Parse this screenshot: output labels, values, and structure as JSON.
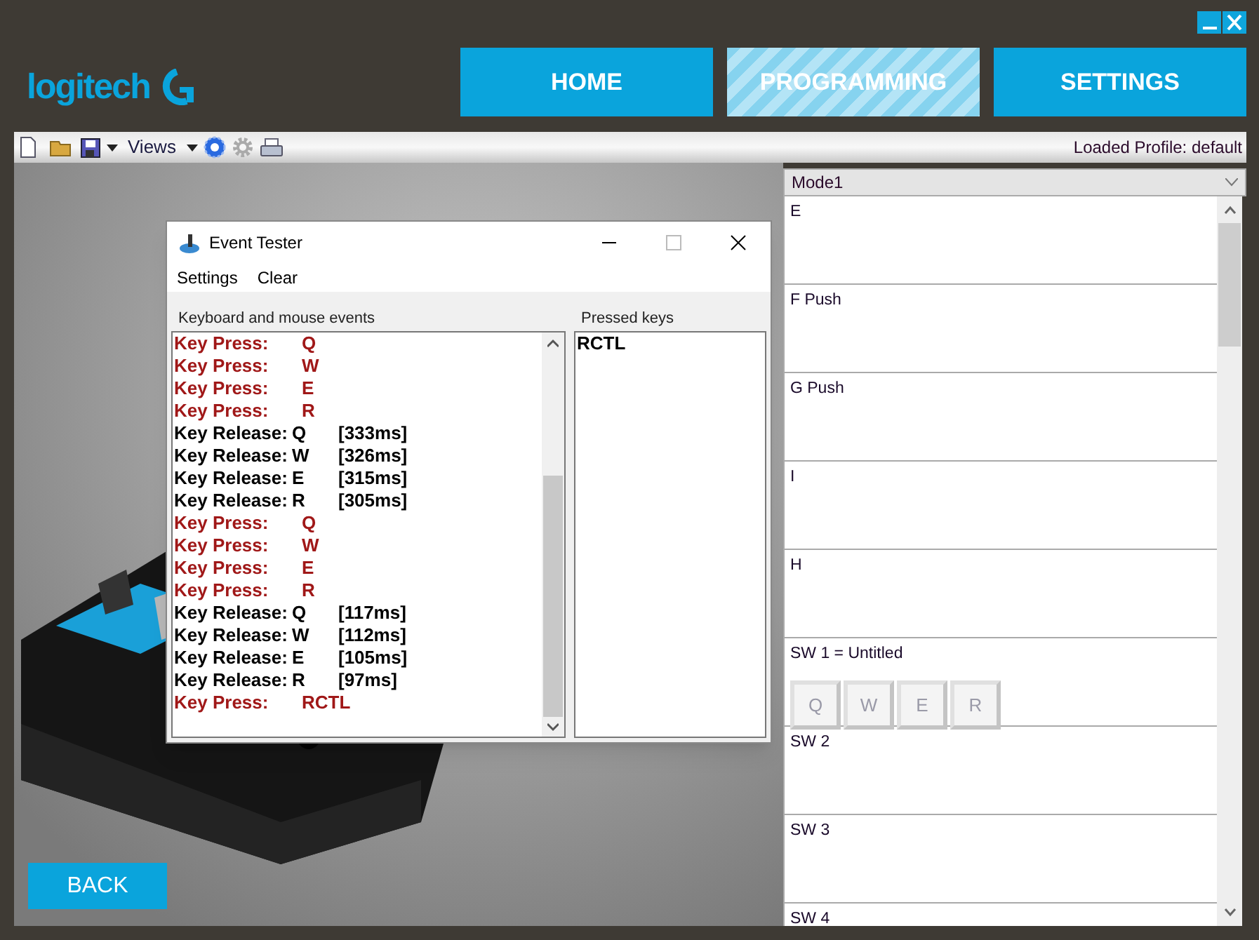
{
  "brand": {
    "wordmark": "logitech"
  },
  "nav_tabs": [
    {
      "label": "HOME",
      "selected": false
    },
    {
      "label": "PROGRAMMING",
      "selected": true
    },
    {
      "label": "SETTINGS",
      "selected": false
    }
  ],
  "toolbar": {
    "views_label": "Views",
    "status": "Loaded Profile: default"
  },
  "event_tester": {
    "title": "Event Tester",
    "menu": [
      "Settings",
      "Clear"
    ],
    "events_label": "Keyboard and mouse events",
    "pressed_label": "Pressed keys",
    "events": [
      {
        "kind": "press",
        "label": "Key Press:",
        "key": "Q"
      },
      {
        "kind": "press",
        "label": "Key Press:",
        "key": "W"
      },
      {
        "kind": "press",
        "label": "Key Press:",
        "key": "E"
      },
      {
        "kind": "press",
        "label": "Key Press:",
        "key": "R"
      },
      {
        "kind": "release",
        "label": "Key Release:",
        "key": "Q",
        "time": "[333ms]"
      },
      {
        "kind": "release",
        "label": "Key Release:",
        "key": "W",
        "time": "[326ms]"
      },
      {
        "kind": "release",
        "label": "Key Release:",
        "key": "E",
        "time": "[315ms]"
      },
      {
        "kind": "release",
        "label": "Key Release:",
        "key": "R",
        "time": "[305ms]"
      },
      {
        "kind": "press",
        "label": "Key Press:",
        "key": "Q"
      },
      {
        "kind": "press",
        "label": "Key Press:",
        "key": "W"
      },
      {
        "kind": "press",
        "label": "Key Press:",
        "key": "E"
      },
      {
        "kind": "press",
        "label": "Key Press:",
        "key": "R"
      },
      {
        "kind": "release",
        "label": "Key Release:",
        "key": "Q",
        "time": "[117ms]"
      },
      {
        "kind": "release",
        "label": "Key Release:",
        "key": "W",
        "time": "[112ms]"
      },
      {
        "kind": "release",
        "label": "Key Release:",
        "key": "E",
        "time": "[105ms]"
      },
      {
        "kind": "release",
        "label": "Key Release:",
        "key": "R",
        "time": "[97ms]"
      },
      {
        "kind": "press",
        "label": "Key Press:",
        "key": "RCTL"
      }
    ],
    "pressed_keys": [
      "RCTL"
    ]
  },
  "mode_select": {
    "value": "Mode1"
  },
  "assignments": [
    {
      "label": "E"
    },
    {
      "label": "F Push"
    },
    {
      "label": "G Push"
    },
    {
      "label": "I"
    },
    {
      "label": "H"
    },
    {
      "label": "SW 1 = Untitled",
      "keys": [
        "Q",
        "W",
        "E",
        "R"
      ]
    },
    {
      "label": "SW 2"
    },
    {
      "label": "SW 3"
    },
    {
      "label": "SW 4"
    }
  ],
  "back_button": "BACK"
}
